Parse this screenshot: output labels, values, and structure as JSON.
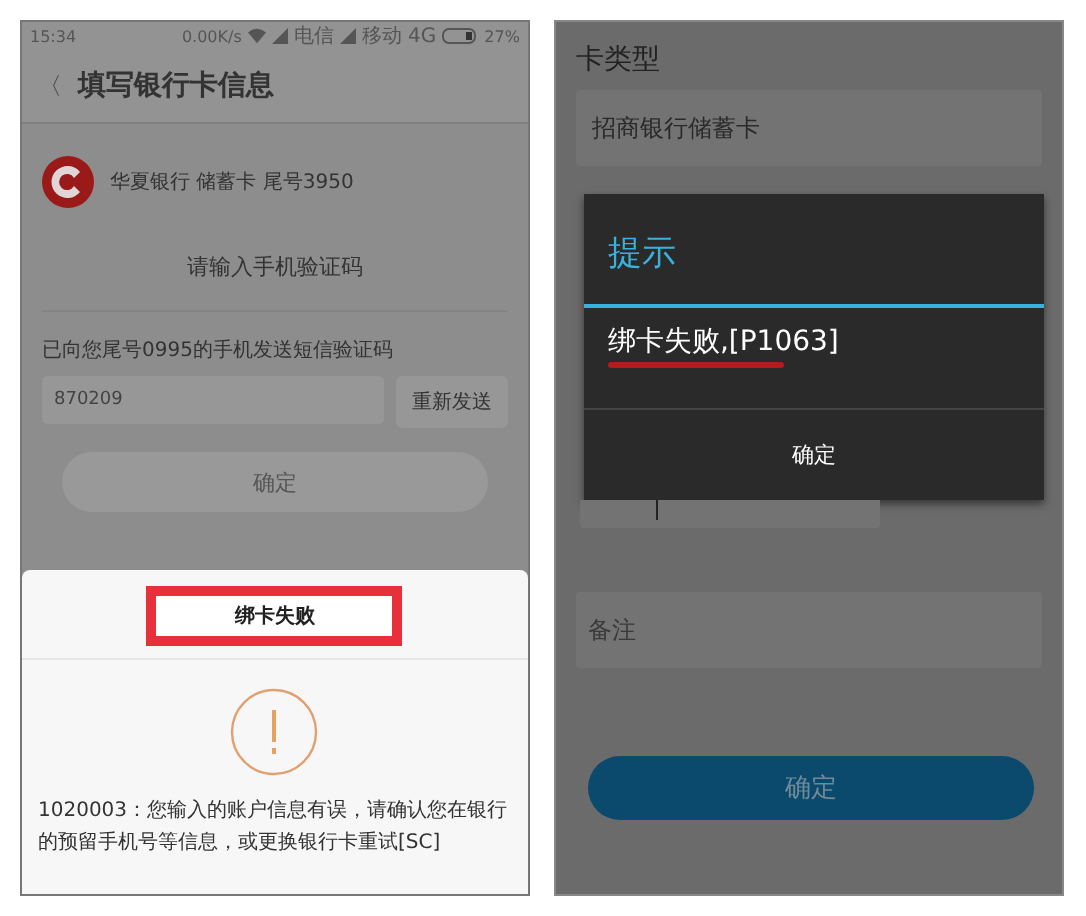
{
  "left_screen": {
    "status_bar": {
      "time": "15:34",
      "speed": "0.00K/s",
      "carrier_1": "电信",
      "carrier_2": "移动 4G",
      "battery": "27%"
    },
    "header": {
      "back": "〈",
      "title": "填写银行卡信息"
    },
    "card": {
      "label": "华夏银行 储蓄卡 尾号3950"
    },
    "prompt": "请输入手机验证码",
    "sms_notice": "已向您尾号0995的手机发送短信验证码",
    "code_field": {
      "value": "870209"
    },
    "resend_button": "重新发送",
    "confirm_button": "确定",
    "dialog": {
      "title": "绑卡失败",
      "message": "1020003：您输入的账户信息有误，请确认您在银行的预留手机号等信息，或更换银行卡重试[SC]"
    }
  },
  "right_screen": {
    "card_type_label": "卡类型",
    "card_type_field": {
      "value": "招商银行储蓄卡"
    },
    "dialog": {
      "title": "提示",
      "message": "绑卡失败,[P1063]",
      "button": "确定"
    },
    "remark_field": {
      "placeholder": "备注"
    },
    "confirm_button": "确定"
  }
}
